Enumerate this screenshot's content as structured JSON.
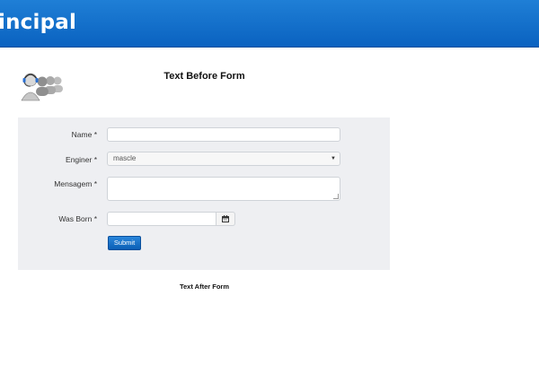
{
  "header": {
    "title": "incipal"
  },
  "page": {
    "text_before_form": "Text Before Form",
    "text_after_form": "Text After Form"
  },
  "form": {
    "name_label": "Name *",
    "engine_label": "Enginer *",
    "engine_value": "mascle",
    "message_label": "Mensagem *",
    "born_label": "Was Born *",
    "submit_label": "Submit"
  },
  "colors": {
    "header_blue": "#0a62c0",
    "form_background": "#eeeff2",
    "submit_blue": "#1a73c9"
  }
}
